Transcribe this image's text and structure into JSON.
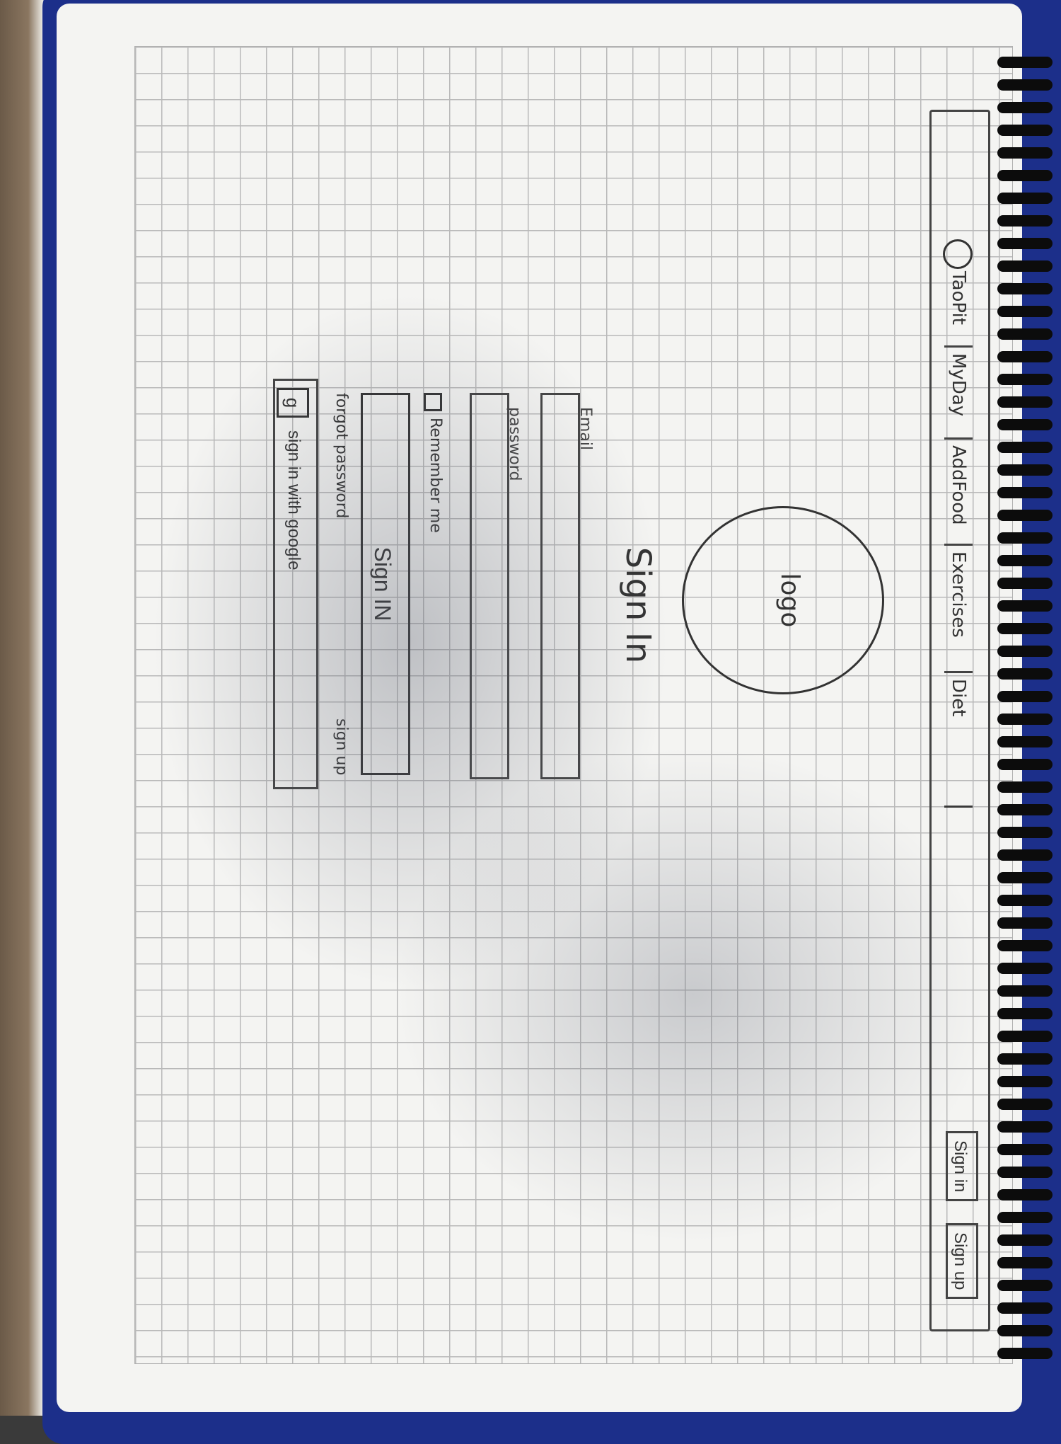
{
  "navbar": {
    "brand": "TaoPit",
    "items": [
      "MyDay",
      "AddFood",
      "Exercises",
      "Diet"
    ],
    "sign_in": "Sign in",
    "sign_up": "Sign up"
  },
  "logo": {
    "text": "logo"
  },
  "form": {
    "title": "Sign In",
    "email_label": "Email",
    "password_label": "password",
    "remember_label": "Remember me",
    "submit_label": "Sign IN",
    "forgot_label": "forgot password",
    "signup_label": "sign up",
    "google_icon": "g",
    "google_label": "sign in with google"
  },
  "icons": {
    "nav_logo": "circle-logo-icon",
    "google": "google-icon",
    "checkbox": "checkbox-icon"
  }
}
